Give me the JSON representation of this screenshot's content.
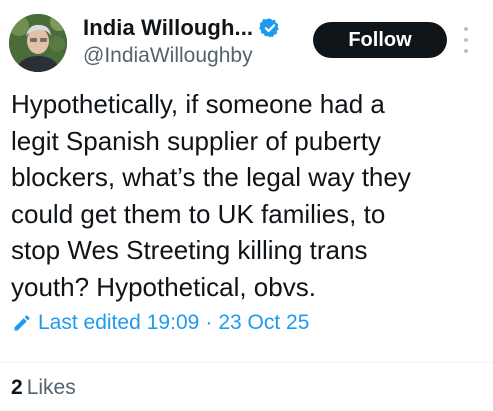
{
  "author": {
    "display_name": "India Willough...",
    "handle": "@IndiaWilloughby",
    "verified_icon": "verified-badge-icon",
    "avatar_icon": "profile-photo"
  },
  "actions": {
    "follow_label": "Follow",
    "more_icon": "more-vertical-icon"
  },
  "tweet": {
    "lines": [
      "Hypothetically, if someone had a",
      "legit Spanish supplier of puberty",
      "blockers, what’s the legal way they",
      "could get them to UK families, to",
      "stop Wes Streeting killing trans",
      "youth? Hypothetical, obvs."
    ]
  },
  "edited": {
    "label": "Last edited",
    "time": "19:09",
    "separator": "·",
    "date": "23 Oct 25",
    "icon": "pencil-icon"
  },
  "stats": {
    "likes_count": "2",
    "likes_label": "Likes"
  },
  "colors": {
    "accent": "#1d9bf0",
    "text": "#0f1419",
    "secondary": "#536471",
    "button": "#0f1419"
  }
}
